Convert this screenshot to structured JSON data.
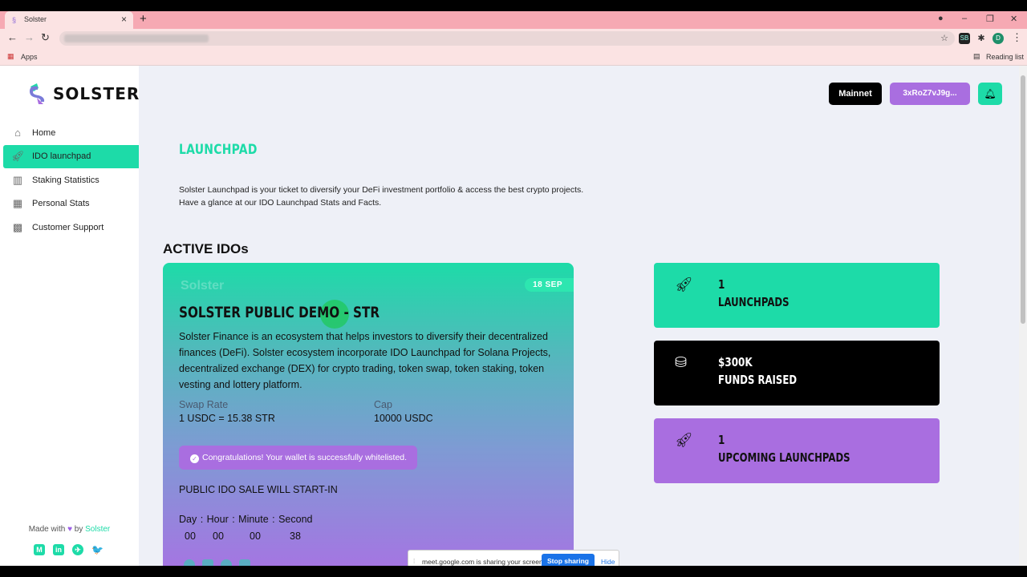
{
  "browser": {
    "tab_title": "Solster",
    "tab_close": "×",
    "new_tab": "+",
    "apps_label": "Apps",
    "reading_list": "Reading list",
    "profile_initial": "D",
    "ext_label": "SB"
  },
  "sidebar": {
    "brand": "SOLSTER",
    "items": [
      {
        "label": "Home",
        "icon": "home-icon"
      },
      {
        "label": "IDO launchpad",
        "icon": "rocket-icon",
        "active": true
      },
      {
        "label": "Staking Statistics",
        "icon": "chart-icon"
      },
      {
        "label": "Personal Stats",
        "icon": "stats-icon"
      },
      {
        "label": "Customer Support",
        "icon": "support-icon"
      }
    ],
    "footer": {
      "made_with": "Made with",
      "heart": "♥",
      "by": "by",
      "brand": "Solster"
    },
    "social": [
      "M",
      "in",
      "✈",
      "🐦"
    ]
  },
  "header": {
    "network": "Mainnet",
    "wallet": "3xRoZ7vJ9g..."
  },
  "main": {
    "title": "LAUNCHPAD",
    "intro_1": "Solster Launchpad is your ticket to diversify your DeFi investment portfolio & access the best crypto projects.",
    "intro_2": "Have a glance at our IDO Launchpad Stats and Facts.",
    "section": "ACTIVE IDOs"
  },
  "ido_card": {
    "ghost_logo": "Solster",
    "date": "18 SEP",
    "title": "SOLSTER PUBLIC DEMO - STR",
    "description": "Solster Finance is an ecosystem that helps investors to diversify their decentralized finances (DeFi). Solster ecosystem incorporate IDO Launchpad for Solana Projects, decentralized exchange (DEX) for crypto trading, token swap, token staking, token vesting and lottery platform.",
    "swap_rate_label": "Swap Rate",
    "swap_rate_value": "1 USDC = 15.38 STR",
    "cap_label": "Cap",
    "cap_value": "10000 USDC",
    "notice": "Congratulations! Your wallet is successfully whitelisted.",
    "sale_text": "PUBLIC IDO SALE WILL START-IN",
    "countdown_header": "Day : Hour : Minute : Second",
    "countdown": {
      "day": "00",
      "hour": "00",
      "minute": "00",
      "second": "38"
    }
  },
  "stats": [
    {
      "number": "1",
      "caption": "LAUNCHPADS",
      "icon": "rocket-icon",
      "color": "#1ddba8"
    },
    {
      "number": "$300K",
      "caption": "FUNDS RAISED",
      "icon": "coins-icon",
      "color": "#000000"
    },
    {
      "number": "1",
      "caption": "UPCOMING LAUNCHPADS",
      "icon": "rocket-icon",
      "color": "#a96ee0"
    }
  ],
  "share_bar": {
    "message": "meet.google.com is sharing your screen.",
    "stop": "Stop sharing",
    "hide": "Hide"
  },
  "colors": {
    "accent": "#1ddba8",
    "purple": "#a96ee0"
  }
}
